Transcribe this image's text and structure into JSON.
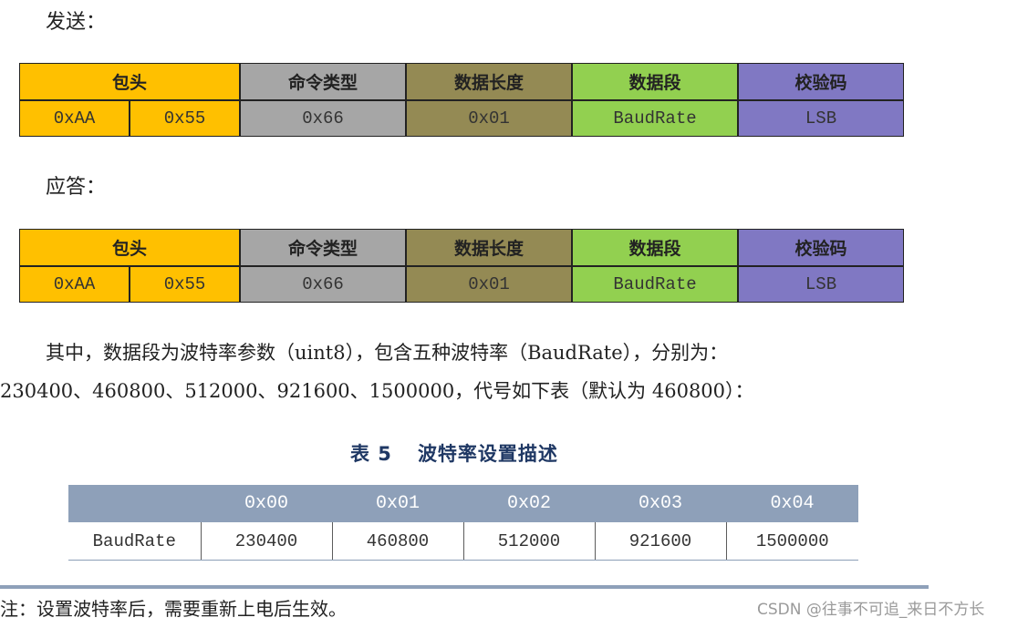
{
  "send_label": "发送：",
  "reply_label": "应答：",
  "frame_headers": [
    "包头",
    "命令类型",
    "数据长度",
    "数据段",
    "校验码"
  ],
  "frame_values": [
    "0xAA",
    "0x55",
    "0x66",
    "0x01",
    "BaudRate",
    "LSB"
  ],
  "frame_colors": {
    "header": "#ffc000",
    "command": "#a6a6a6",
    "length": "#948a54",
    "data": "#92d050",
    "checksum": "#8078c3"
  },
  "paragraph": {
    "line1": "其中，数据段为波特率参数（uint8），包含五种波特率（BaudRate），分别为：",
    "line2": "230400、460800、512000、921600、1500000，代号如下表（默认为 460800）："
  },
  "table_caption": {
    "number": "表 5",
    "title": "波特率设置描述",
    "color": "#1f3864"
  },
  "baud_table": {
    "header_bg": "#8ea0b9",
    "columns": [
      "",
      "0x00",
      "0x01",
      "0x02",
      "0x03",
      "0x04"
    ],
    "row": [
      "BaudRate",
      "230400",
      "460800",
      "512000",
      "921600",
      "1500000"
    ]
  },
  "rule_color": "#8ea0b9",
  "note": "注：设置波特率后，需要重新上电后生效。",
  "watermark": "CSDN @往事不可追_来日不方长"
}
